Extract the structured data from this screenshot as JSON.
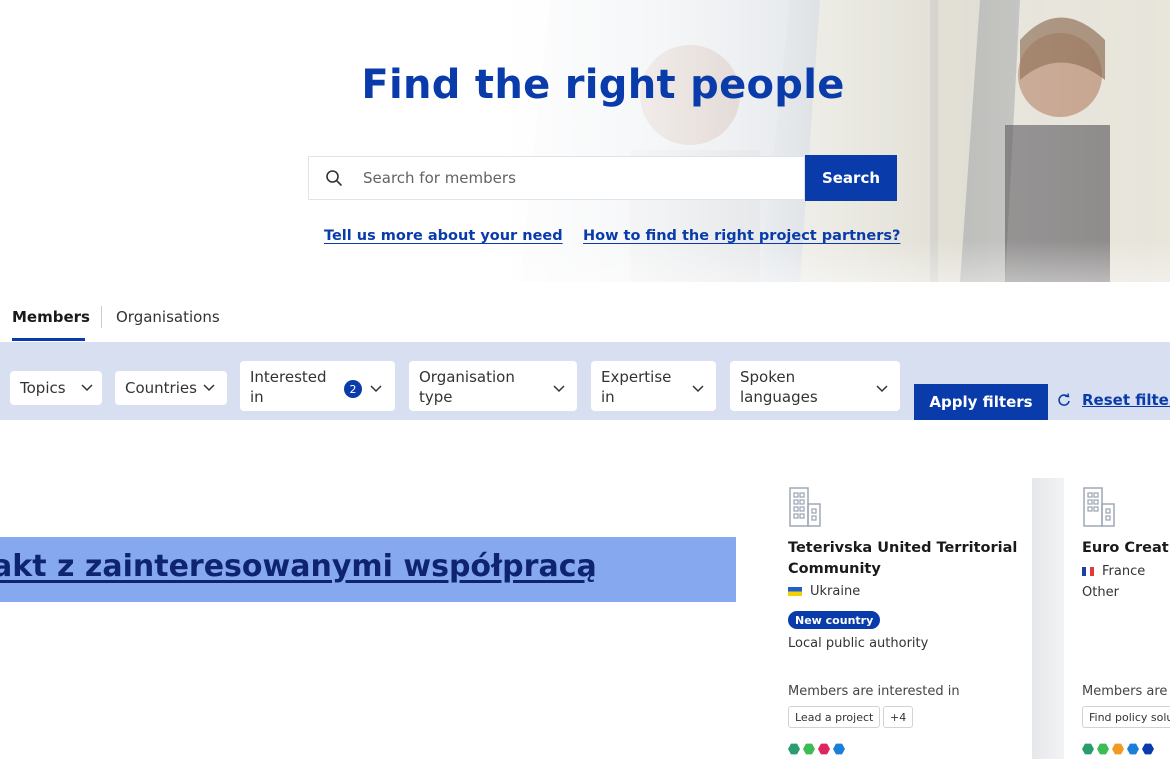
{
  "hero": {
    "title": "Find the right people",
    "search_placeholder": "Search for members",
    "search_button": "Search",
    "link_need": "Tell us more about your need",
    "link_partners": "How to find the right project partners?"
  },
  "tabs": [
    {
      "label": "Members",
      "active": true
    },
    {
      "label": "Organisations",
      "active": false
    }
  ],
  "filters": {
    "topics": "Topics",
    "countries": "Countries",
    "interested_in": "Interested in",
    "interested_in_count": "2",
    "organisation_type": "Organisation type",
    "expertise_in": "Expertise in",
    "spoken_languages": "Spoken languages",
    "apply": "Apply filters",
    "reset": "Reset filters"
  },
  "banner": {
    "text": "akt z zainteresowanymi współpracą"
  },
  "cards": [
    {
      "title": "Teterivska United Territorial Community",
      "country": "Ukraine",
      "badge": "New country",
      "type": "Local public authority",
      "interest_label": "Members are interested in",
      "tags": [
        "Lead a project",
        "+4"
      ]
    },
    {
      "title": "Euro Creativ",
      "country": "France",
      "type": "Other",
      "interest_label": "Members are i",
      "tags": [
        "Find policy solu"
      ]
    }
  ],
  "colors": {
    "brand": "#0a3bab",
    "filter_bar": "#d8dff0",
    "banner": "#86a8ef"
  }
}
